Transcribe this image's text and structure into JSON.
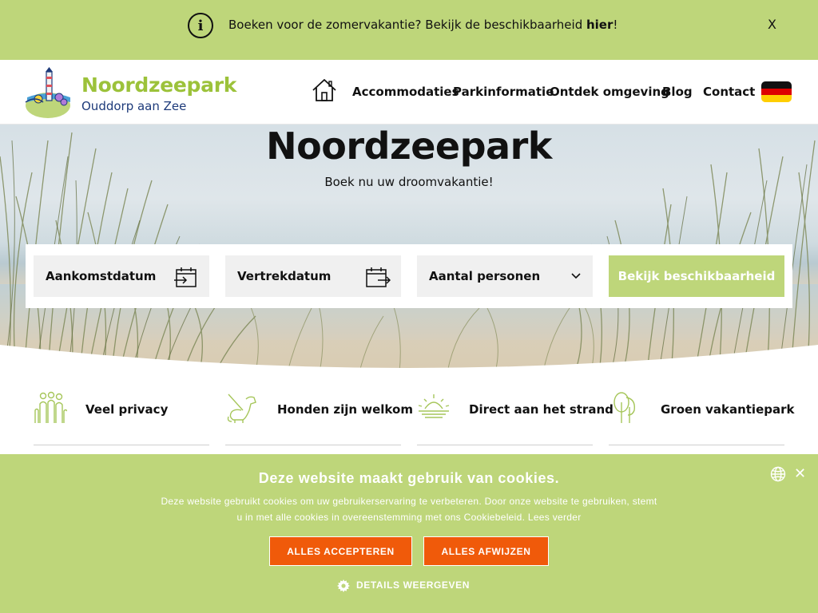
{
  "notice": {
    "text_before": "Boeken voor de zomervakantie? Bekijk de beschikbaarheid ",
    "link": "hier",
    "text_after": "!",
    "close": "X"
  },
  "header": {
    "brand_name": "Noordzeepark",
    "brand_sub": "Ouddorp aan Zee",
    "nav": [
      "Accommodaties",
      "Parkinformatie",
      "Ontdek omgeving",
      "Blog",
      "Contact"
    ],
    "home_icon": "home-icon",
    "language_flag": "german-flag"
  },
  "hero": {
    "title": "Noordzeepark",
    "subtitle": "Boek nu uw droomvakantie!"
  },
  "booking": {
    "arrival": "Aankomstdatum",
    "departure": "Vertrekdatum",
    "persons": "Aantal personen",
    "button": "Bekijk beschikbaarheid"
  },
  "features": [
    {
      "label": "Veel privacy",
      "icon": "people-icon"
    },
    {
      "label": "Honden zijn welkom",
      "icon": "dog-icon"
    },
    {
      "label": "Direct aan het strand",
      "icon": "sunset-icon"
    },
    {
      "label": "Groen vakantiepark",
      "icon": "trees-icon"
    }
  ],
  "cookie": {
    "title": "Deze website maakt gebruik van cookies.",
    "text": "Deze website gebruikt cookies om uw gebruikerservaring te verbeteren. Door onze website te gebruiken, stemt u in met alle cookies in overeenstemming met ons Cookiebeleid. Lees verder",
    "accept": "ALLES ACCEPTEREN",
    "reject": "ALLES AFWIJZEN",
    "details": "DETAILS WEERGEVEN",
    "close": "✕"
  },
  "colors": {
    "brand_green": "#bed67a",
    "logo_green": "#9cc23a",
    "logo_blue": "#1d3a7a",
    "cookie_button": "#f05a0a"
  }
}
